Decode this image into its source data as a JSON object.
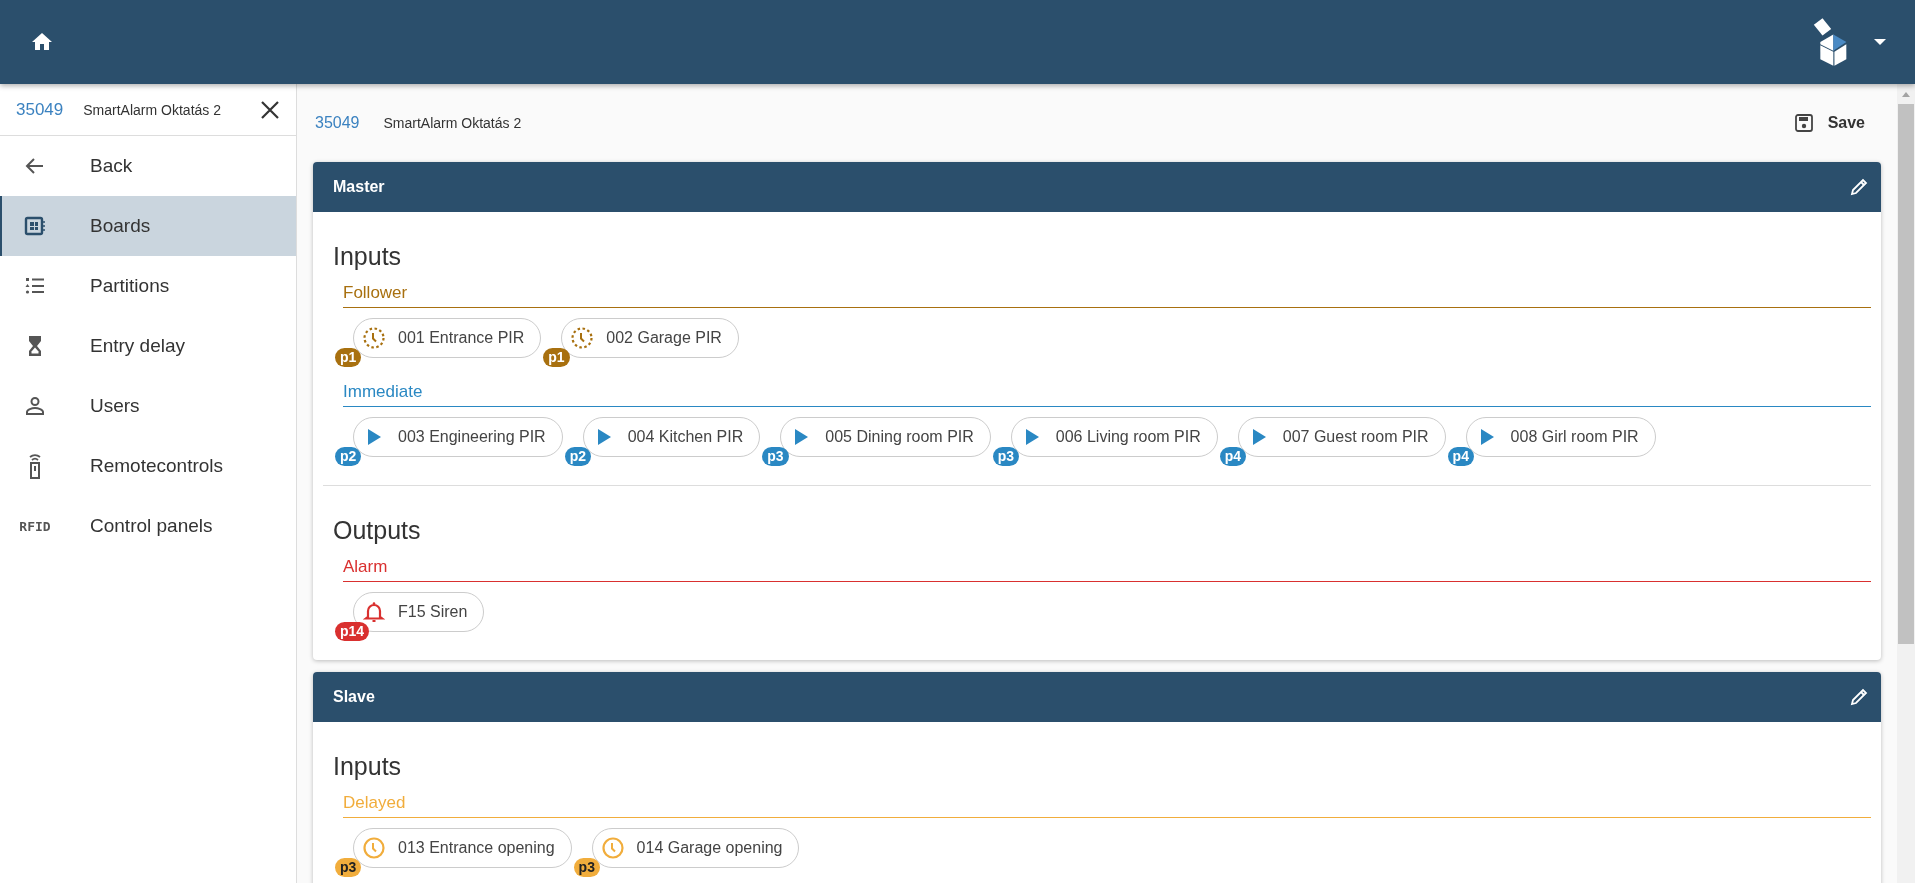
{
  "sidebar": {
    "header": {
      "id": "35049",
      "name": "SmartAlarm Oktatás 2"
    },
    "items": [
      {
        "label": "Back",
        "selected": false
      },
      {
        "label": "Boards",
        "selected": true
      },
      {
        "label": "Partitions",
        "selected": false
      },
      {
        "label": "Entry delay",
        "selected": false
      },
      {
        "label": "Users",
        "selected": false
      },
      {
        "label": "Remotecontrols",
        "selected": false
      },
      {
        "label": "Control panels",
        "selected": false,
        "icon_text": "RFID"
      }
    ]
  },
  "page": {
    "id": "35049",
    "name": "SmartAlarm Oktatás 2",
    "save": "Save"
  },
  "boards": [
    {
      "title": "Master",
      "sections": [
        {
          "title": "Inputs",
          "groups": [
            {
              "kind": "follower",
              "label": "Follower",
              "color": "#a8700f",
              "chips": [
                {
                  "badge": "p1",
                  "label": "001 Entrance PIR"
                },
                {
                  "badge": "p1",
                  "label": "002 Garage PIR"
                }
              ]
            },
            {
              "kind": "immediate",
              "label": "Immediate",
              "color": "#2a88c3",
              "chips": [
                {
                  "badge": "p2",
                  "label": "003 Engineering PIR"
                },
                {
                  "badge": "p2",
                  "label": "004 Kitchen PIR"
                },
                {
                  "badge": "p3",
                  "label": "005 Dining room PIR"
                },
                {
                  "badge": "p3",
                  "label": "006 Living room PIR"
                },
                {
                  "badge": "p4",
                  "label": "007 Guest room PIR"
                },
                {
                  "badge": "p4",
                  "label": "008 Girl room PIR"
                }
              ]
            }
          ]
        },
        {
          "title": "Outputs",
          "groups": [
            {
              "kind": "alarm",
              "label": "Alarm",
              "color": "#d9302f",
              "chips": [
                {
                  "badge": "p14",
                  "label": "F15 Siren"
                }
              ]
            }
          ]
        }
      ]
    },
    {
      "title": "Slave",
      "sections": [
        {
          "title": "Inputs",
          "groups": [
            {
              "kind": "delayed",
              "label": "Delayed",
              "color": "#f1ad3c",
              "chips": [
                {
                  "badge": "p3",
                  "label": "013 Entrance opening"
                },
                {
                  "badge": "p3",
                  "label": "014 Garage opening"
                }
              ]
            }
          ]
        }
      ]
    }
  ]
}
